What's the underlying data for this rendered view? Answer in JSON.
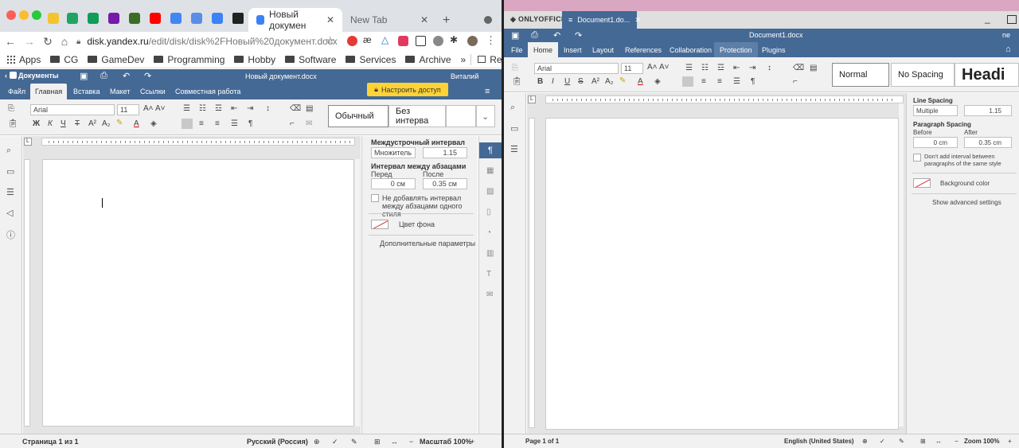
{
  "browser": {
    "tabs": [
      {
        "label": "Новый докумен",
        "active": true
      },
      {
        "label": "New Tab",
        "active": false
      }
    ],
    "new_tab_symbol": "+",
    "url_host": "disk.yandex.ru",
    "url_path": "/edit/disk/disk%2FНовый%20документ.docx",
    "bookmarks": [
      {
        "label": "Apps",
        "icon": "apps-grid-icon"
      },
      {
        "label": "CG",
        "icon": "folder-icon"
      },
      {
        "label": "GameDev",
        "icon": "folder-icon"
      },
      {
        "label": "Programming",
        "icon": "folder-icon"
      },
      {
        "label": "Hobby",
        "icon": "folder-icon"
      },
      {
        "label": "Software",
        "icon": "folder-icon"
      },
      {
        "label": "Services",
        "icon": "folder-icon"
      },
      {
        "label": "Archive",
        "icon": "folder-icon"
      }
    ],
    "bookmarks_more": "»",
    "reading_list": "Reading list"
  },
  "yandex_editor": {
    "app_name": "Документы",
    "doc_title": "Новый документ.docx",
    "user": "Виталий",
    "tabs": [
      "Файл",
      "Главная",
      "Вставка",
      "Макет",
      "Ссылки",
      "Совместная работа"
    ],
    "active_tab": "Главная",
    "access_button": "Настроить доступ",
    "font": "Arial",
    "font_size": "11",
    "styles": [
      "Обычный",
      "Без интерва"
    ],
    "right_panel": {
      "line_spacing_title": "Междустрочный интервал",
      "line_spacing_mode": "Множитель",
      "line_spacing_value": "1.15",
      "paragraph_spacing_title": "Интервал между абзацами",
      "before_label": "Перед",
      "after_label": "После",
      "before_value": "0 см",
      "after_value": "0.35 см",
      "no_interval_label": "Не добавлять интервал между абзацами одного стиля",
      "bg_color_label": "Цвет фона",
      "advanced_link": "Дополнительные параметры"
    },
    "status": {
      "page": "Страница 1 из 1",
      "language": "Русский (Россия)",
      "zoom": "Масштаб 100%"
    }
  },
  "onlyoffice": {
    "logo": "ONLYOFFICE",
    "doc_tab": "Document1.do...",
    "doc_title": "Document1.docx",
    "user_initial": "ne",
    "tabs": [
      "File",
      "Home",
      "Insert",
      "Layout",
      "References",
      "Collaboration",
      "Protection",
      "Plugins"
    ],
    "active_tab": "Home",
    "font": "Arial",
    "font_size": "11",
    "styles": [
      "Normal",
      "No Spacing",
      "Headi"
    ],
    "right_panel": {
      "line_spacing_title": "Line Spacing",
      "line_spacing_mode": "Multiple",
      "line_spacing_value": "1.15",
      "paragraph_spacing_title": "Paragraph Spacing",
      "before_label": "Before",
      "after_label": "After",
      "before_value": "0 cm",
      "after_value": "0.35 cm",
      "no_interval_label": "Don't add interval between paragraphs of the same style",
      "bg_color_label": "Background color",
      "advanced_link": "Show advanced settings"
    },
    "status": {
      "page": "Page 1 of 1",
      "language": "English (United States)",
      "zoom": "Zoom 100%"
    }
  },
  "colors": {
    "editor_blue": "#446995",
    "access_yellow": "#ffd335",
    "desktop_pink": "#e8b0c8"
  }
}
